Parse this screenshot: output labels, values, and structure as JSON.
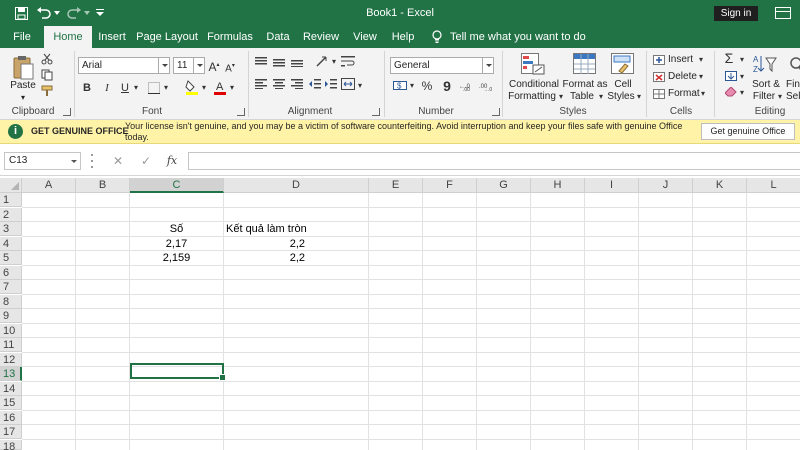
{
  "window": {
    "title": "Book1  -  Excel",
    "signin_label": "Sign in"
  },
  "tabs": [
    {
      "label": "File"
    },
    {
      "label": "Home"
    },
    {
      "label": "Insert"
    },
    {
      "label": "Page Layout"
    },
    {
      "label": "Formulas"
    },
    {
      "label": "Data"
    },
    {
      "label": "Review"
    },
    {
      "label": "View"
    },
    {
      "label": "Help"
    }
  ],
  "tell_me": "Tell me what you want to do",
  "ribbon": {
    "clipboard": {
      "paste_label": "Paste",
      "group_label": "Clipboard"
    },
    "font": {
      "font_name": "Arial",
      "font_size": "11",
      "group_label": "Font",
      "bold": "B",
      "italic": "I",
      "underline": "U"
    },
    "alignment": {
      "group_label": "Alignment"
    },
    "number": {
      "format": "General",
      "group_label": "Number",
      "currency": "$",
      "percent": "%",
      "comma": "9"
    },
    "styles": {
      "conditional_formatting_1": "Conditional",
      "conditional_formatting_2": "Formatting",
      "format_as_table_1": "Format as",
      "format_as_table_2": "Table",
      "cell_styles_1": "Cell",
      "cell_styles_2": "Styles",
      "group_label": "Styles"
    },
    "cells": {
      "insert": "Insert",
      "delete": "Delete",
      "format": "Format",
      "group_label": "Cells"
    },
    "editing": {
      "sort_filter_1": "Sort &",
      "sort_filter_2": "Filter",
      "find_select_1": "Find",
      "find_select_2": "Sele",
      "group_label": "Editing"
    }
  },
  "notice": {
    "title": "GET GENUINE OFFICE",
    "message": "Your license isn't genuine, and you may be a victim of software counterfeiting. Avoid interruption and keep your files safe with genuine Office today.",
    "button": "Get genuine Office"
  },
  "formula_bar": {
    "name_box": "C13",
    "cancel": "✕",
    "enter": "✓",
    "fx": "fx",
    "value": ""
  },
  "columns": [
    "A",
    "B",
    "C",
    "D",
    "E",
    "F",
    "G",
    "H",
    "I",
    "J",
    "K",
    "L"
  ],
  "rows": [
    "1",
    "2",
    "3",
    "4",
    "5",
    "6",
    "7",
    "8",
    "9",
    "10",
    "11",
    "12",
    "13",
    "14",
    "15",
    "16",
    "17",
    "18"
  ],
  "cells": {
    "C3": "Số",
    "D3": "Kết quả làm tròn",
    "C4": "2,17",
    "D4": "2,2",
    "C5": "2,159",
    "D5": "2,2"
  },
  "selection": {
    "column": "C",
    "row": "13"
  },
  "colors": {
    "accent": "#217346",
    "notice_bg": "#fff3a8"
  }
}
